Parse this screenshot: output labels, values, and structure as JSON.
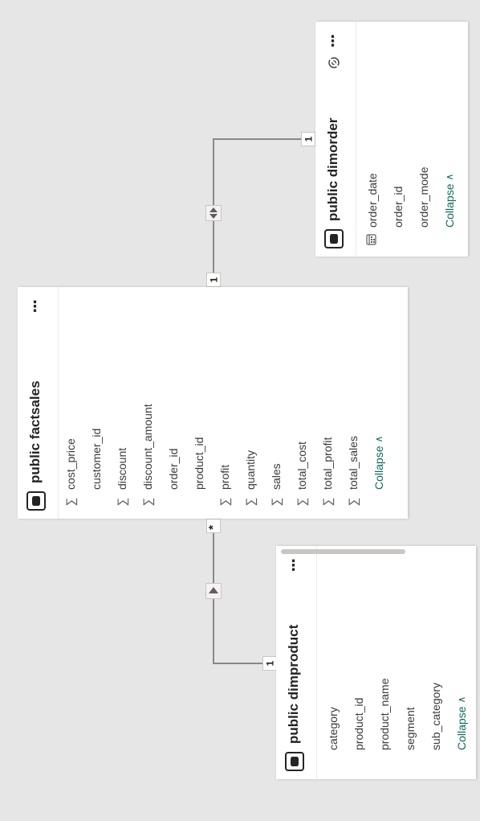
{
  "tables": {
    "dimorder": {
      "title": "public dimorder",
      "fields": [
        {
          "label": "order_date",
          "icon": "calendar-icon"
        },
        {
          "label": "order_id",
          "icon": ""
        },
        {
          "label": "order_mode",
          "icon": ""
        }
      ],
      "collapse_label": "Collapse",
      "more_label": "⋮"
    },
    "factsales": {
      "title": "public factsales",
      "fields": [
        {
          "label": "cost_price",
          "icon": "sigma-icon"
        },
        {
          "label": "customer_id",
          "icon": ""
        },
        {
          "label": "discount",
          "icon": "sigma-icon"
        },
        {
          "label": "discount_amount",
          "icon": "sigma-icon"
        },
        {
          "label": "order_id",
          "icon": ""
        },
        {
          "label": "product_id",
          "icon": ""
        },
        {
          "label": "profit",
          "icon": "sigma-icon"
        },
        {
          "label": "quantity",
          "icon": "sigma-icon"
        },
        {
          "label": "sales",
          "icon": "sigma-icon"
        },
        {
          "label": "total_cost",
          "icon": "sigma-icon"
        },
        {
          "label": "total_profit",
          "icon": "sigma-icon"
        },
        {
          "label": "total_sales",
          "icon": "sigma-icon"
        }
      ],
      "collapse_label": "Collapse",
      "more_label": "⋮"
    },
    "dimproduct": {
      "title": "public dimproduct",
      "fields": [
        {
          "label": "category",
          "icon": ""
        },
        {
          "label": "product_id",
          "icon": ""
        },
        {
          "label": "product_name",
          "icon": ""
        },
        {
          "label": "segment",
          "icon": ""
        },
        {
          "label": "sub_category",
          "icon": ""
        }
      ],
      "collapse_label": "Collapse",
      "more_label": "⋮"
    }
  },
  "relationships": {
    "order_fact": {
      "from_cardinality": "1",
      "to_cardinality": "1",
      "direction": "both"
    },
    "product_fact": {
      "from_cardinality": "1",
      "to_cardinality": "*",
      "direction": "single"
    }
  },
  "colors": {
    "canvas": "#e6e6e6",
    "accent": "#0b6a5a"
  },
  "icons": {
    "sigma": "∑",
    "calendar": "calendar-icon",
    "table": "table-icon",
    "eye": "eye-icon"
  }
}
